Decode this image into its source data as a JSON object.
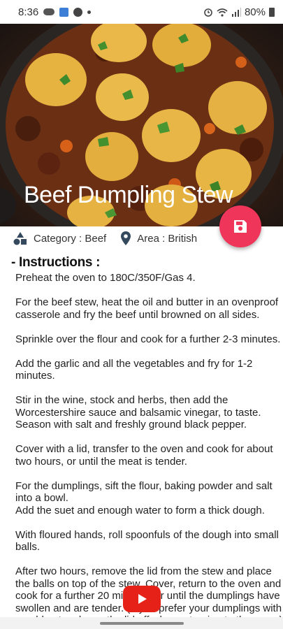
{
  "status_bar": {
    "time": "8:36",
    "battery": "80%"
  },
  "recipe": {
    "title": "Beef Dumpling Stew",
    "category": "Category : Beef",
    "area": "Area : British"
  },
  "instructions": {
    "heading": "- Instructions :",
    "paragraphs": [
      "Preheat the oven to 180C/350F/Gas 4.",
      "For the beef stew, heat the oil and butter in an ovenproof casserole and fry the beef until browned on all sides.",
      "Sprinkle over the flour and cook for a further 2-3 minutes.",
      "Add the garlic and all the vegetables and fry for 1-2 minutes.",
      "Stir in the wine, stock and herbs, then add the Worcestershire sauce and balsamic vinegar, to taste. Season with salt and freshly ground black pepper.",
      "Cover with a lid, transfer to the oven and cook for about two hours, or until the meat is tender.",
      "For the dumplings, sift the flour, baking powder and salt into a bowl.",
      "Add the suet and enough water to form a thick dough.",
      "With floured hands, roll spoonfuls of the dough into small balls.",
      "After two hours, remove the lid from the stew and place the balls on top of the stew. Cover, return to the oven and cook for a further 20 minutes, or until the dumplings have swollen and are tender. (If you prefer your dumplings with a golden top, leave the lid off when returning to the oven.)"
    ]
  },
  "colors": {
    "fab": "#f0355a",
    "youtube": "#e62117"
  },
  "icons": {
    "category": "shapes-icon",
    "area": "location-pin-icon",
    "save": "floppy-disk-icon",
    "youtube": "youtube-play-icon"
  }
}
